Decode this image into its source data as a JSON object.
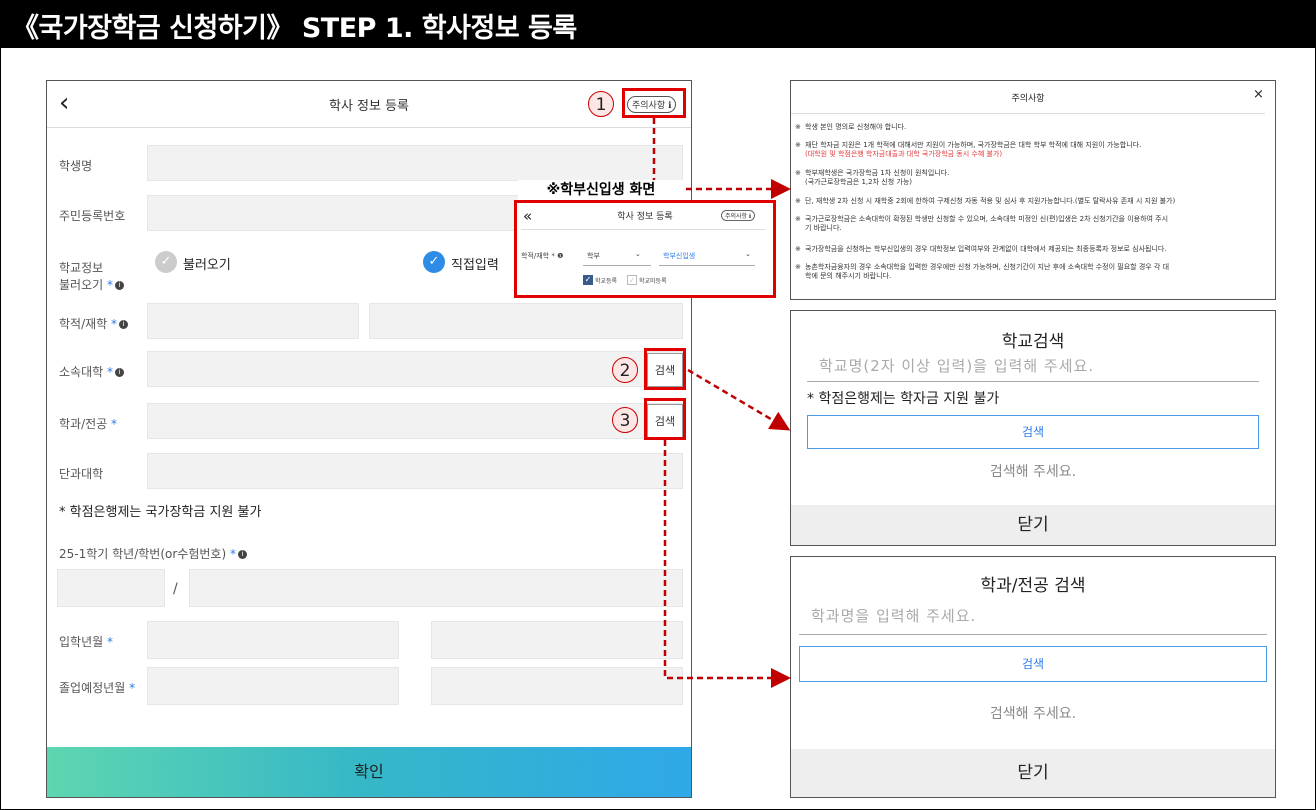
{
  "page_title": "《국가장학금 신청하기》 STEP 1. 학사정보 등록",
  "form": {
    "back_icon": "‹",
    "header_title": "학사 정보 등록",
    "caution_button": "주의사항 ℹ",
    "fields": {
      "student_name": "학생명",
      "resident_number": "주민등록번호",
      "school_info_line1": "학교정보",
      "school_info_line2": "불러오기",
      "enrollment_status": "학적/재학",
      "university": "소속대학",
      "department": "학과/전공",
      "college": "단과대학",
      "semester_id": "25-1학기 학년/학번(or수험번호)",
      "admission_date": "입학년월",
      "graduation_date": "졸업예정년월"
    },
    "required_mark": "*",
    "info_mark": "i",
    "radio_load": "불러오기",
    "radio_manual": "직접입력",
    "search_button": "검색",
    "slash": "/",
    "credit_bank_notice": "* 학점은행제는 국가장학금 지원 불가",
    "confirm_button": "확인"
  },
  "callouts": [
    "1",
    "2",
    "3"
  ],
  "freshman": {
    "label": "※학부신입생 화면",
    "back_icon": "«",
    "title": "학사 정보 등록",
    "caution_button": "주의사항 ℹ",
    "field_label": "학적/재학 * ❶",
    "select1": "학부",
    "select2": "학부신입생",
    "checkbox1": "학교등록",
    "checkbox2": "학교미등록"
  },
  "caution_panel": {
    "title": "주의사항",
    "close_icon": "×",
    "mark": "※",
    "items": [
      {
        "text": "학생 본인 명의로 신청해야 합니다."
      },
      {
        "text": "재단 학자금 지원은 1개 학적에 대해서만 지원이 가능하며, 국가장학금은 대학 학부 학적에 대해 지원이 가능합니다.",
        "red": "(대학원 및 학점은행 학자금대출과 대학 국가장학금 동시 수혜 불가)"
      },
      {
        "text": "학부재학생은 국가장학금 1차 신청이 원칙입니다.",
        "sub": "(국가근로장학금은 1,2차 신청 가능)"
      },
      {
        "text": "단, 재학생 2차 신청 시 재학중 2회에 한하여 구제신청 자동 적용 및 심사 후 지원가능합니다.(별도 탈락사유 존재 시 지원 불가)"
      },
      {
        "text": "국가근로장학금은 소속대학이 확정된 학생만 신청할 수 있으며, 소속대학 미정인 신(편)입생은 2차 신청기간을 이용하여 주시",
        "sub": "기 바랍니다."
      },
      {
        "text": "국가장학금을 신청하는 학부신입생의 경우 대학정보 입력여부와 관계없이 대학에서 제공되는 최종등록자 정보로 심사됩니다."
      },
      {
        "text": "농촌학자금융자의 경우 소속대학을 입력한 경우에만 신청 가능하며, 신청기간이 지난 후에 소속대학 수정이 필요할 경우 각 대",
        "sub": "학에 문의 해주시기 바랍니다."
      }
    ]
  },
  "school_search": {
    "title": "학교검색",
    "placeholder": "학교명(2자 이상 입력)을 입력해 주세요.",
    "note": "* 학점은행제는 학자금 지원 불가",
    "button": "검색",
    "empty": "검색해 주세요.",
    "close": "닫기"
  },
  "dept_search": {
    "title": "학과/전공 검색",
    "placeholder": "학과명을 입력해 주세요.",
    "button": "검색",
    "empty": "검색해 주세요.",
    "close": "닫기"
  },
  "colors": {
    "highlight": "#e00000",
    "accent": "#2b7de9",
    "confirm_gradient": [
      "#5ed6b0",
      "#2fa8e8"
    ]
  }
}
